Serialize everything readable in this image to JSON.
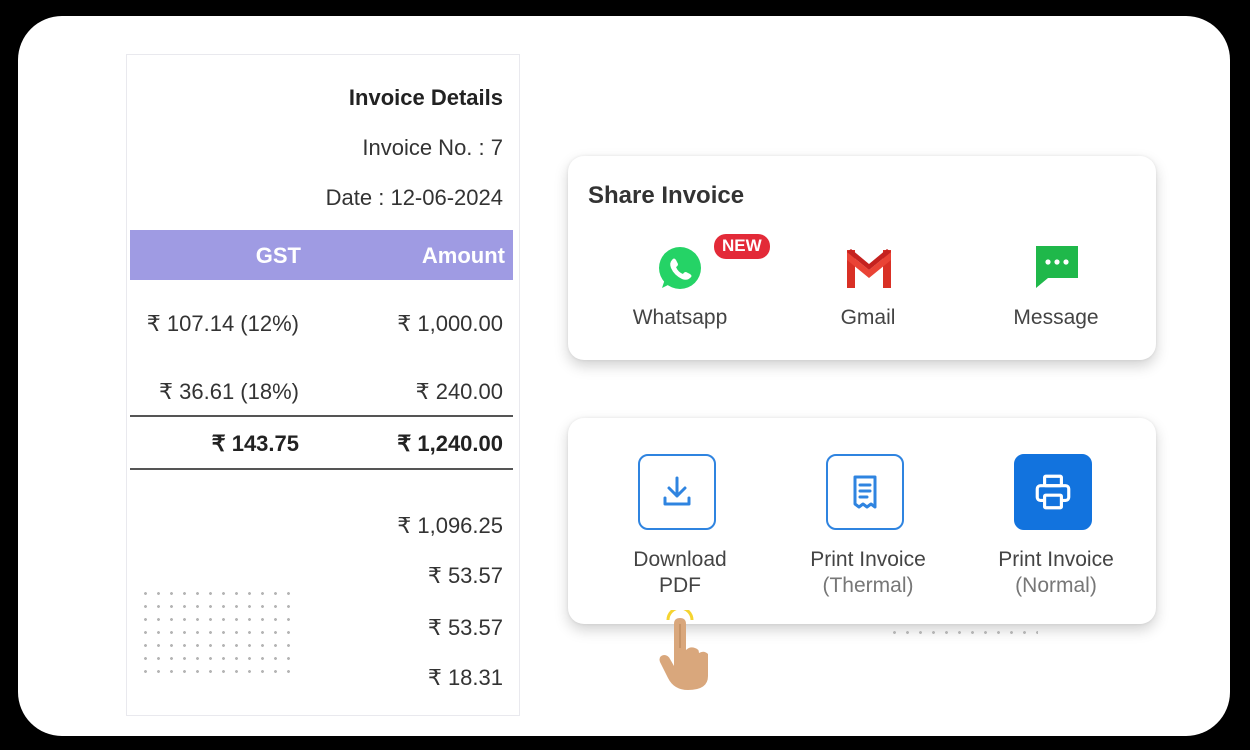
{
  "invoice": {
    "title": "Invoice Details",
    "number": "Invoice No. : 7",
    "date": "Date : 12-06-2024",
    "headers": {
      "gst": "GST",
      "amount": "Amount"
    },
    "rows": [
      {
        "gst": "₹ 107.14 (12%)",
        "amount": "₹ 1,000.00"
      },
      {
        "gst": "₹ 36.61 (18%)",
        "amount": "₹ 240.00"
      }
    ],
    "totals": {
      "gst": "₹ 143.75",
      "amount": "₹ 1,240.00"
    },
    "summary": [
      "₹ 1,096.25",
      "₹ 53.57",
      "₹ 53.57",
      "₹ 18.31"
    ]
  },
  "share": {
    "title": "Share Invoice",
    "badge": "NEW",
    "options": [
      {
        "label": "Whatsapp",
        "icon": "whatsapp-icon"
      },
      {
        "label": "Gmail",
        "icon": "gmail-icon"
      },
      {
        "label": "Message",
        "icon": "message-icon"
      }
    ]
  },
  "actions": [
    {
      "line1": "Download",
      "line2": "PDF",
      "icon": "download-icon"
    },
    {
      "line1": "Print Invoice",
      "line2": "(Thermal)",
      "icon": "receipt-icon"
    },
    {
      "line1": "Print Invoice",
      "line2": "(Normal)",
      "icon": "printer-icon"
    }
  ],
  "colors": {
    "header": "#9f9be3",
    "primary": "#1273de",
    "badge": "#e32a38",
    "whatsapp": "#25d366",
    "message": "#1fb84a"
  }
}
